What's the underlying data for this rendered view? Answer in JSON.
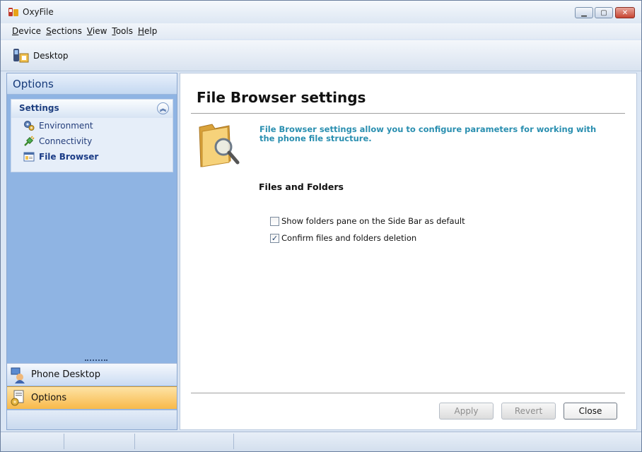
{
  "window": {
    "title": "OxyFile"
  },
  "menu": [
    {
      "mnemonic": "D",
      "rest": "evice"
    },
    {
      "mnemonic": "S",
      "rest": "ections"
    },
    {
      "mnemonic": "V",
      "rest": "iew"
    },
    {
      "mnemonic": "T",
      "rest": "ools"
    },
    {
      "mnemonic": "H",
      "rest": "elp"
    }
  ],
  "toolbar": {
    "desktop_label": "Desktop"
  },
  "sidebar": {
    "header": "Options",
    "group_title": "Settings",
    "items": [
      {
        "label": "Environment",
        "icon": "gears-icon"
      },
      {
        "label": "Connectivity",
        "icon": "plug-icon"
      },
      {
        "label": "File Browser",
        "icon": "file-browser-icon",
        "active": true
      }
    ],
    "sections": [
      {
        "label": "Phone Desktop",
        "icon": "phone-desktop-icon"
      },
      {
        "label": "Options",
        "icon": "options-icon",
        "active": true
      }
    ]
  },
  "content": {
    "title": "File Browser settings",
    "description": "File Browser settings allow you to configure parameters for working with the phone file structure.",
    "section_title": "Files and Folders",
    "options": [
      {
        "label": "Show folders pane on the Side Bar as default",
        "checked": false
      },
      {
        "label": "Confirm files and folders deletion",
        "checked": true
      }
    ],
    "buttons": {
      "apply": "Apply",
      "revert": "Revert",
      "close": "Close"
    }
  },
  "colors": {
    "accent": "#2a8fb0",
    "sidebar_bg": "#8fb4e3",
    "active_section": "#f8b94a"
  }
}
